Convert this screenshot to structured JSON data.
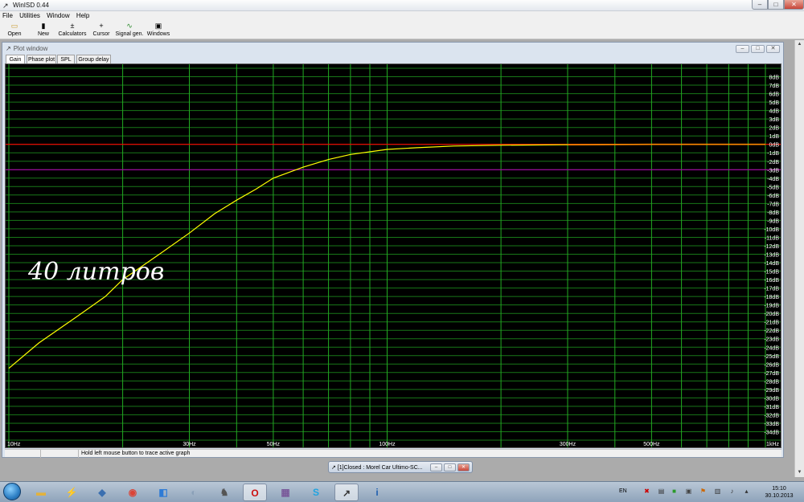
{
  "window": {
    "title": "WinISD 0.44"
  },
  "menu": [
    "File",
    "Utilities",
    "Window",
    "Help"
  ],
  "toolbar": [
    {
      "label": "Open",
      "icon": "folder-open-icon",
      "glyph": "▭"
    },
    {
      "label": "New",
      "icon": "new-document-icon",
      "glyph": "▮"
    },
    {
      "label": "Calculators",
      "icon": "calculator-icon",
      "glyph": "±"
    },
    {
      "label": "Cursor",
      "icon": "cursor-crosshair-icon",
      "glyph": "+"
    },
    {
      "label": "Signal gen.",
      "icon": "signal-generator-icon",
      "glyph": "∿"
    },
    {
      "label": "Windows",
      "icon": "windows-icon",
      "glyph": "▣"
    }
  ],
  "plot_window": {
    "title": "Plot window",
    "tabs": [
      "Gain",
      "Phase plot",
      "SPL",
      "Group delay"
    ],
    "active_tab": "Gain",
    "annotation": "40 литров",
    "status": [
      "",
      "",
      "Hold left mouse button to trace active graph"
    ]
  },
  "minimized_window": {
    "title": "[1]Closed : Morel Car Ultimo-SC..."
  },
  "taskbar": {
    "language": "EN",
    "time": "15:10",
    "date": "30.10.2013",
    "apps": [
      {
        "icon": "explorer-icon",
        "glyph": "▬"
      },
      {
        "icon": "winamp-icon",
        "glyph": "⚡"
      },
      {
        "icon": "app-icon",
        "glyph": "◆"
      },
      {
        "icon": "chrome-icon",
        "glyph": "◉"
      },
      {
        "icon": "document-app-icon",
        "glyph": "◧"
      },
      {
        "icon": "tool-app-icon",
        "glyph": "◐"
      },
      {
        "icon": "fox-app-icon",
        "glyph": "♞"
      },
      {
        "icon": "opera-icon",
        "glyph": "O"
      },
      {
        "icon": "installer-icon",
        "glyph": "▦"
      },
      {
        "icon": "skype-icon",
        "glyph": "S"
      },
      {
        "icon": "winisd-icon",
        "glyph": "↗"
      },
      {
        "icon": "info-app-icon",
        "glyph": "i"
      }
    ]
  },
  "colors": {
    "graph_bg": "#000000",
    "grid": "#22aa22",
    "zero_line": "#ff0000",
    "minus3_line": "#aa00aa",
    "curve": "#ffff00",
    "curve_tail": "#ff8800",
    "annotation": "#ffffff"
  },
  "chart_data": {
    "type": "line",
    "x_scale": "log",
    "xlim": [
      10,
      1000
    ],
    "ylim": [
      -35,
      9
    ],
    "x_ticks": [
      {
        "value": 10,
        "label": "10Hz"
      },
      {
        "value": 30,
        "label": "30Hz"
      },
      {
        "value": 50,
        "label": "50Hz"
      },
      {
        "value": 100,
        "label": "100Hz"
      },
      {
        "value": 300,
        "label": "300Hz"
      },
      {
        "value": 500,
        "label": "500Hz"
      },
      {
        "value": 1000,
        "label": "1kHz"
      }
    ],
    "y_ticks": [
      "8dB",
      "7dB",
      "6dB",
      "5dB",
      "4dB",
      "3dB",
      "2dB",
      "1dB",
      "0dB",
      "-1dB",
      "-2dB",
      "-3dB",
      "-4dB",
      "-5dB",
      "-6dB",
      "-7dB",
      "-8dB",
      "-9dB",
      "-10dB",
      "-11dB",
      "-12dB",
      "-13dB",
      "-14dB",
      "-15dB",
      "-16dB",
      "-17dB",
      "-18dB",
      "-19dB",
      "-20dB",
      "-21dB",
      "-22dB",
      "-23dB",
      "-24dB",
      "-25dB",
      "-26dB",
      "-27dB",
      "-28dB",
      "-29dB",
      "-30dB",
      "-31dB",
      "-32dB",
      "-33dB",
      "-34dB"
    ],
    "reference_lines": [
      {
        "y": 0
      },
      {
        "y": -3
      }
    ],
    "series": [
      {
        "x": [
          10,
          12,
          15,
          18,
          20,
          25,
          30,
          35,
          40,
          45,
          50,
          60,
          70,
          80,
          100,
          120,
          150,
          200,
          300,
          500,
          700,
          1000
        ],
        "y": [
          -26.5,
          -23.5,
          -20.5,
          -18,
          -16,
          -13,
          -10.5,
          -8.2,
          -6.6,
          -5.3,
          -4,
          -2.7,
          -1.8,
          -1.2,
          -0.6,
          -0.4,
          -0.2,
          -0.1,
          -0.05,
          0,
          0,
          0
        ]
      }
    ]
  }
}
